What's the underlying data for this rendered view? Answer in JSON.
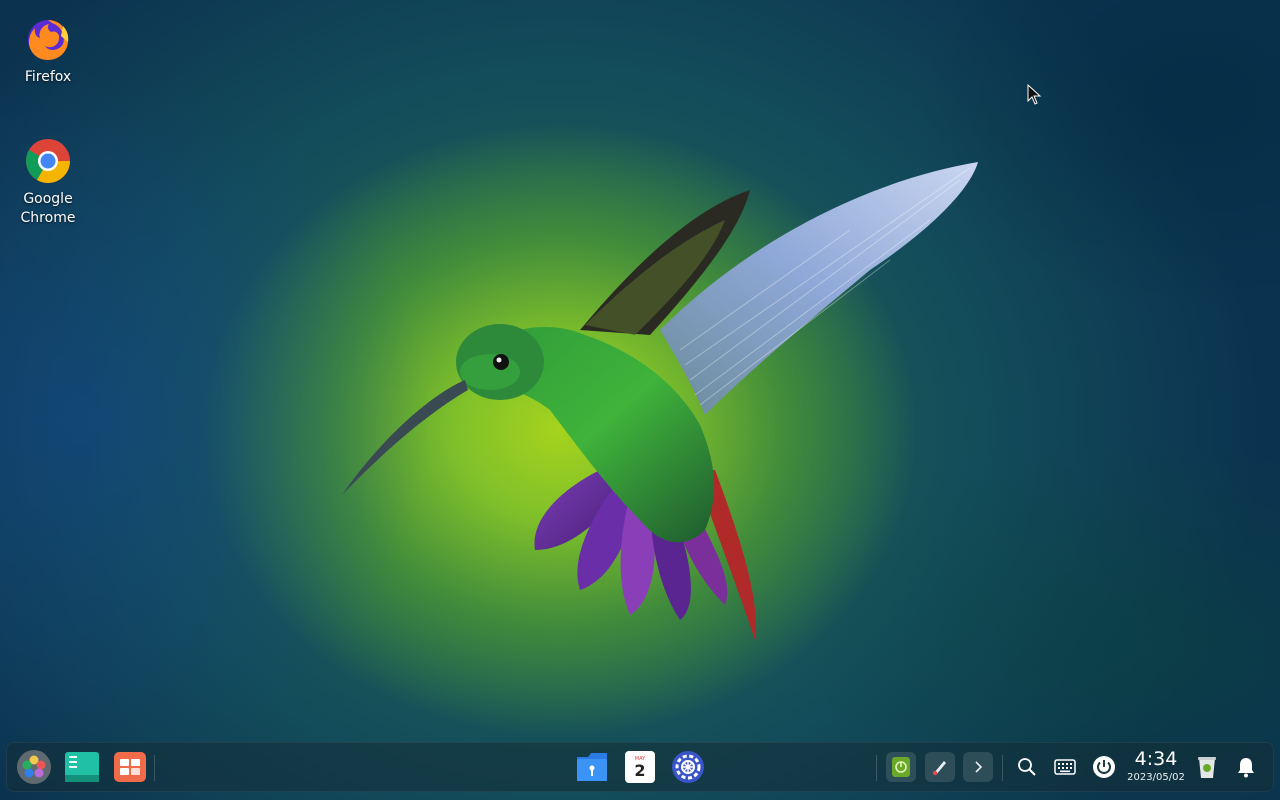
{
  "desktop": {
    "icons": [
      {
        "label": "Firefox"
      },
      {
        "label": "Google\nChrome"
      }
    ]
  },
  "taskbar": {
    "left_apps": [
      {
        "icon": "launcher-icon"
      },
      {
        "icon": "multitasking-view-icon"
      },
      {
        "icon": "app-store-icon"
      }
    ],
    "center_apps": [
      {
        "icon": "file-manager-icon"
      },
      {
        "icon": "calendar-icon",
        "calendar_month": "MAY",
        "calendar_day": "2"
      },
      {
        "icon": "system-settings-icon"
      }
    ],
    "tray": [
      {
        "icon": "package-manager-tray-icon"
      },
      {
        "icon": "screen-brush-tray-icon"
      },
      {
        "icon": "expand-tray-chevron-icon"
      },
      {
        "icon": "search-icon"
      },
      {
        "icon": "keyboard-icon"
      },
      {
        "icon": "power-icon"
      }
    ],
    "clock": {
      "time": "4:34",
      "date": "2023/05/02"
    },
    "trash": {
      "icon": "trash-icon"
    },
    "notifications": {
      "icon": "bell-icon"
    }
  },
  "colors": {
    "accent_blue": "#2c7be5",
    "app_store": "#f06b4a",
    "multitask": "#1fc0a3"
  }
}
